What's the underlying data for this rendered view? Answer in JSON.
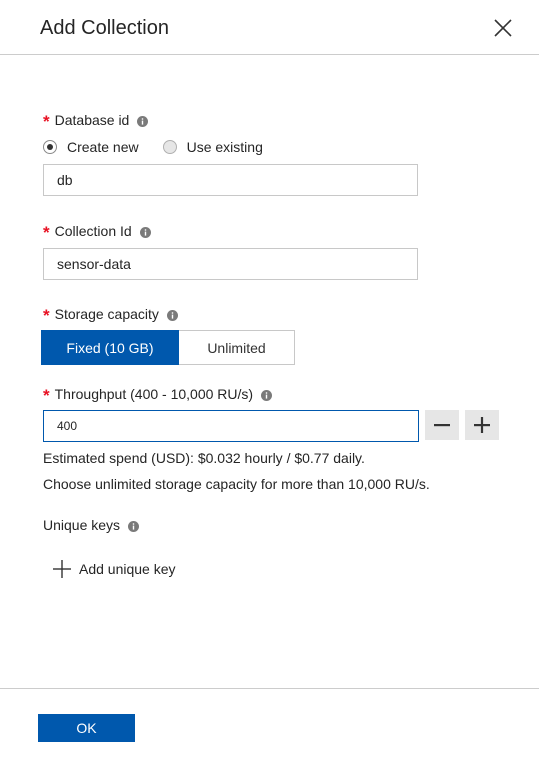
{
  "header": {
    "title": "Add Collection"
  },
  "fields": {
    "database_id": {
      "label": "Database id",
      "required_marker": "*",
      "value": "db",
      "radio_options": [
        "Create new",
        "Use existing"
      ],
      "selected_option": "Create new"
    },
    "collection_id": {
      "label": "Collection Id",
      "required_marker": "*",
      "value": "sensor-data"
    },
    "storage_capacity": {
      "label": "Storage capacity",
      "required_marker": "*",
      "options": [
        "Fixed (10 GB)",
        "Unlimited"
      ],
      "selected_option": "Fixed (10 GB)"
    },
    "throughput": {
      "label": "Throughput (400 - 10,000 RU/s)",
      "required_marker": "*",
      "value": "400",
      "estimated_spend": "Estimated spend (USD): $0.032 hourly / $0.77 daily.",
      "note": "Choose unlimited storage capacity for more than 10,000 RU/s."
    },
    "unique_keys": {
      "label": "Unique keys",
      "add_label": "Add unique key"
    }
  },
  "footer": {
    "ok_label": "OK"
  },
  "colors": {
    "accent": "#0058ad",
    "required": "#e81123",
    "border": "#c8c8c8",
    "button_gray": "#e6e6e6"
  },
  "icons": {
    "close": "close-icon",
    "info": "info-icon",
    "minus": "minus-icon",
    "plus": "plus-icon",
    "add": "add-icon"
  }
}
